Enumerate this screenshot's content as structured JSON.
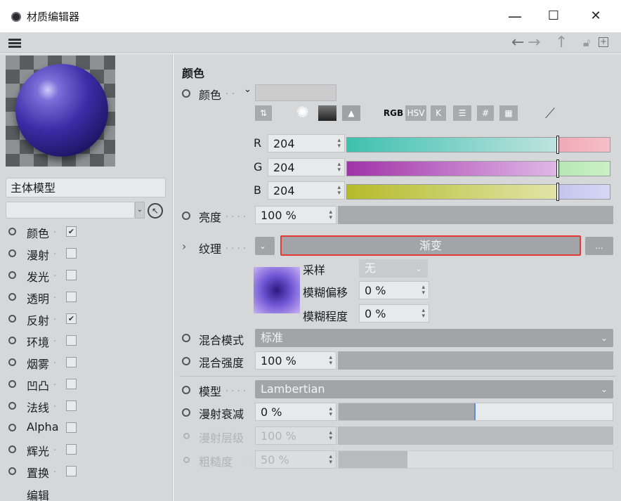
{
  "window": {
    "title": "材质编辑器"
  },
  "titlebar_controls": {
    "minimize": "—",
    "maximize": "☐",
    "close": "✕"
  },
  "sidebar": {
    "material_name": "主体模型",
    "channels": [
      {
        "label": "颜色",
        "checked": true
      },
      {
        "label": "漫射",
        "checked": false
      },
      {
        "label": "发光",
        "checked": false
      },
      {
        "label": "透明",
        "checked": false
      },
      {
        "label": "反射",
        "checked": true
      },
      {
        "label": "环境",
        "checked": false
      },
      {
        "label": "烟雾",
        "checked": false
      },
      {
        "label": "凹凸",
        "checked": false
      },
      {
        "label": "法线",
        "checked": false
      },
      {
        "label": "Alpha",
        "checked": false
      },
      {
        "label": "辉光",
        "checked": false
      },
      {
        "label": "置换",
        "checked": false
      }
    ],
    "edit_label": "编辑"
  },
  "color_section": {
    "heading": "颜色",
    "color_label": "颜色",
    "tool_labels": {
      "rgb": "RGB",
      "hsv": "HSV",
      "k": "K",
      "hash": "#"
    },
    "r_label": "R",
    "r_value": "204",
    "g_label": "G",
    "g_value": "204",
    "b_label": "B",
    "b_value": "204",
    "r_fraction": 0.8,
    "g_fraction": 0.8,
    "b_fraction": 0.8,
    "swatch_color": "#cccccc"
  },
  "brightness": {
    "label": "亮度",
    "value": "100 %"
  },
  "texture": {
    "label": "纹理",
    "shader": "渐变",
    "more": "...",
    "sampling_label": "采样",
    "sampling_value": "无",
    "blur_offset_label": "模糊偏移",
    "blur_offset_value": "0 %",
    "blur_scale_label": "模糊程度",
    "blur_scale_value": "0 %"
  },
  "mix": {
    "mode_label": "混合模式",
    "mode_value": "标准",
    "strength_label": "混合强度",
    "strength_value": "100 %"
  },
  "model": {
    "label": "模型",
    "value": "Lambertian",
    "diffuse_falloff_label": "漫射衰减",
    "diffuse_falloff_value": "0 %",
    "diffuse_level_label": "漫射层级",
    "diffuse_level_value": "100 %",
    "roughness_label": "粗糙度",
    "roughness_value": "50 %",
    "diffuse_falloff_fraction": 0.5,
    "roughness_fraction": 0.25
  },
  "colors": {
    "panel": "#d6d7d9",
    "highlight": "#e53935",
    "sphere": "#3c2ca6"
  }
}
